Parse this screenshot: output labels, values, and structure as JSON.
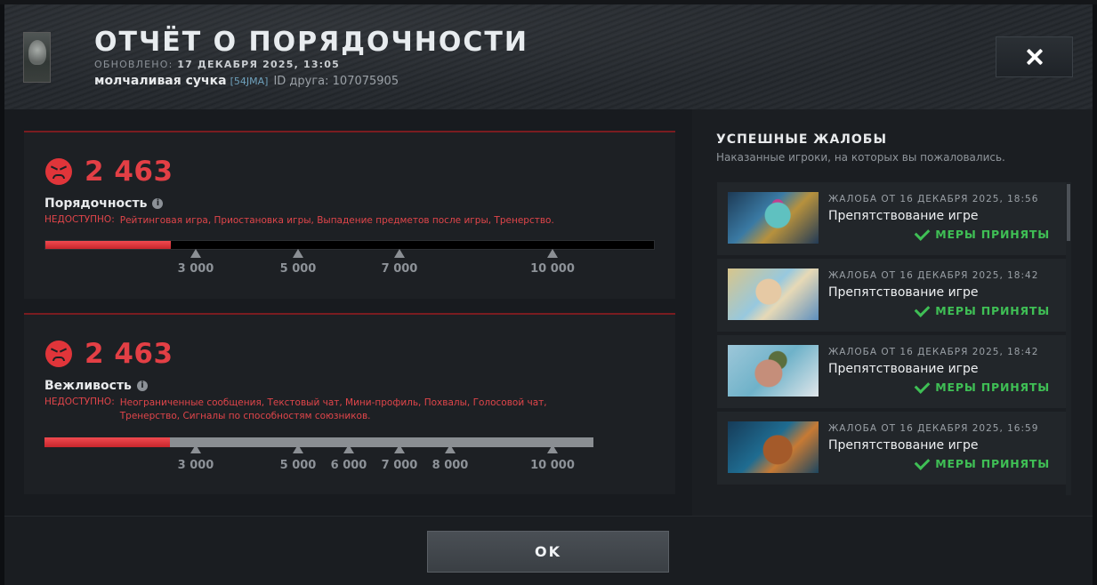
{
  "header": {
    "title": "ОТЧЁТ О ПОРЯДОЧНОСТИ",
    "updated_label": "ОБНОВЛЕНО:",
    "updated_value": "17 ДЕКАБРЯ 2025, 13:05",
    "username": "молчаливая сучка",
    "user_tag": "[54JMA]",
    "friend_id": "ID друга: 107075905",
    "close_icon": "close-icon"
  },
  "conduct": {
    "score": "2 463",
    "label": "Порядочность",
    "unavailable_label": "НЕДОСТУПНО:",
    "unavailable_text": "Рейтинговая игра, Приостановка игры, Выпадение предметов после игры, Тренерство.",
    "progress_fraction": 0.2463,
    "ticks": [
      "3 000",
      "5 000",
      "7 000",
      "10 000"
    ],
    "colors": {
      "fill": "#e33f45",
      "track": "#000000"
    }
  },
  "courtesy": {
    "score": "2 463",
    "label": "Вежливость",
    "unavailable_label": "НЕДОСТУПНО:",
    "unavailable_text": "Неограниченные сообщения, Текстовый чат, Мини-профиль, Похвалы, Голосовой чат, Тренерство, Сигналы по способностям союзников.",
    "progress_fraction": 0.2463,
    "ticks": [
      "3 000",
      "5 000",
      "6 000",
      "7 000",
      "8 000",
      "10 000"
    ],
    "colors": {
      "fill": "#e33f45",
      "track": "#8a8e92"
    }
  },
  "reports_panel": {
    "title": "УСПЕШНЫЕ ЖАЛОБЫ",
    "subtitle": "Наказанные игроки, на которых вы пожаловались.",
    "items": [
      {
        "date": "ЖАЛОБА ОТ 16 ДЕКАБРЯ 2025, 18:56",
        "reason": "Препятствование игре",
        "status": "МЕРЫ ПРИНЯТЫ"
      },
      {
        "date": "ЖАЛОБА ОТ 16 ДЕКАБРЯ 2025, 18:42",
        "reason": "Препятствование игре",
        "status": "МЕРЫ ПРИНЯТЫ"
      },
      {
        "date": "ЖАЛОБА ОТ 16 ДЕКАБРЯ 2025, 18:42",
        "reason": "Препятствование игре",
        "status": "МЕРЫ ПРИНЯТЫ"
      },
      {
        "date": "ЖАЛОБА ОТ 16 ДЕКАБРЯ 2025, 16:59",
        "reason": "Препятствование игре",
        "status": "МЕРЫ ПРИНЯТЫ"
      }
    ],
    "status_color": "#3fbf55"
  },
  "footer": {
    "ok_label": "OK"
  }
}
